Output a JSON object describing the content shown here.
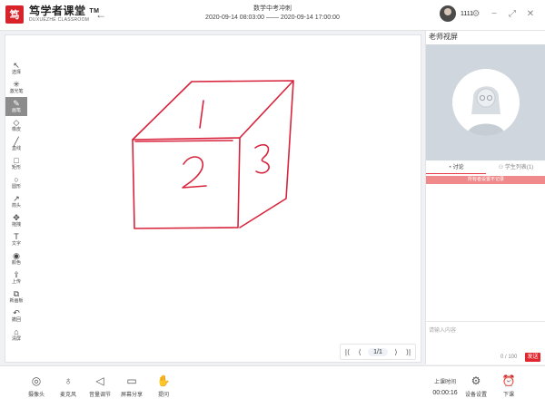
{
  "header": {
    "logo_mark": "笃",
    "logo_name": "笃学者课堂",
    "logo_tm": "TM",
    "logo_sub": "DUXUEZHE CLASSROOM",
    "back_icon": "back-arrow-icon",
    "course_title": "数学中考冲刺",
    "course_time": "2020-09-14 08:03:00 —— 2020-09-14 17:00:00",
    "user_name": "1111",
    "icons": [
      "gear-icon",
      "minimize-icon",
      "restore-icon",
      "close-icon"
    ]
  },
  "toolbar": {
    "items": [
      {
        "label": "选择",
        "icon": "select-icon",
        "glyph": "↖",
        "active": false
      },
      {
        "label": "激光笔",
        "icon": "laser-pointer-icon",
        "glyph": "✳",
        "active": false
      },
      {
        "label": "画笔",
        "icon": "pen-icon",
        "glyph": "✎",
        "active": true
      },
      {
        "label": "橡皮",
        "icon": "eraser-icon",
        "glyph": "◇",
        "active": false
      },
      {
        "label": "直线",
        "icon": "line-icon",
        "glyph": "╱",
        "active": false
      },
      {
        "label": "矩形",
        "icon": "rectangle-icon",
        "glyph": "□",
        "active": false
      },
      {
        "label": "圆形",
        "icon": "circle-icon",
        "glyph": "○",
        "active": false
      },
      {
        "label": "箭头",
        "icon": "arrow-icon",
        "glyph": "↗",
        "active": false
      },
      {
        "label": "拖拽",
        "icon": "move-icon",
        "glyph": "✥",
        "active": false
      },
      {
        "label": "文字",
        "icon": "text-icon",
        "glyph": "T",
        "active": false
      },
      {
        "label": "颜色",
        "icon": "palette-icon",
        "glyph": "◉",
        "active": false
      },
      {
        "label": "上传",
        "icon": "upload-icon",
        "glyph": "⇪",
        "active": false
      },
      {
        "label": "新画板",
        "icon": "new-board-icon",
        "glyph": "⧉",
        "active": false
      },
      {
        "label": "撤回",
        "icon": "undo-icon",
        "glyph": "↶",
        "active": false
      },
      {
        "label": "清屏",
        "icon": "clear-icon",
        "glyph": "⌂",
        "active": false
      }
    ]
  },
  "drawing": {
    "stroke_color": "#d8233c",
    "labels": [
      "1",
      "2",
      "3"
    ]
  },
  "pager": {
    "first": "|⟨",
    "prev": "⟨",
    "page": "1/1",
    "next": "⟩",
    "last": "⟩|"
  },
  "panel": {
    "title": "老师视屏",
    "tab_discussion": "讨论",
    "tab_students": "学生列表(1)",
    "notice": "所有者设置不记录",
    "input_placeholder": "请输入内容",
    "counter": "0 / 100",
    "send": "发送"
  },
  "bottom": {
    "buttons": [
      {
        "label": "摄像头",
        "icon": "camera-icon",
        "glyph": "◎"
      },
      {
        "label": "麦克风",
        "icon": "microphone-icon",
        "glyph": "♁"
      },
      {
        "label": "音量调节",
        "icon": "volume-icon",
        "glyph": "◁"
      },
      {
        "label": "屏幕分享",
        "icon": "screen-share-icon",
        "glyph": "▭"
      },
      {
        "label": "提问",
        "icon": "raise-hand-icon",
        "glyph": "✋"
      }
    ],
    "class_time_label": "上课时间",
    "class_time": "00:00:16",
    "settings": "设备设置",
    "leave": "下课"
  },
  "colors": {
    "accent": "#e2262d",
    "notice_bg": "#f08a8a",
    "active_tool": "#8c8c8c"
  }
}
